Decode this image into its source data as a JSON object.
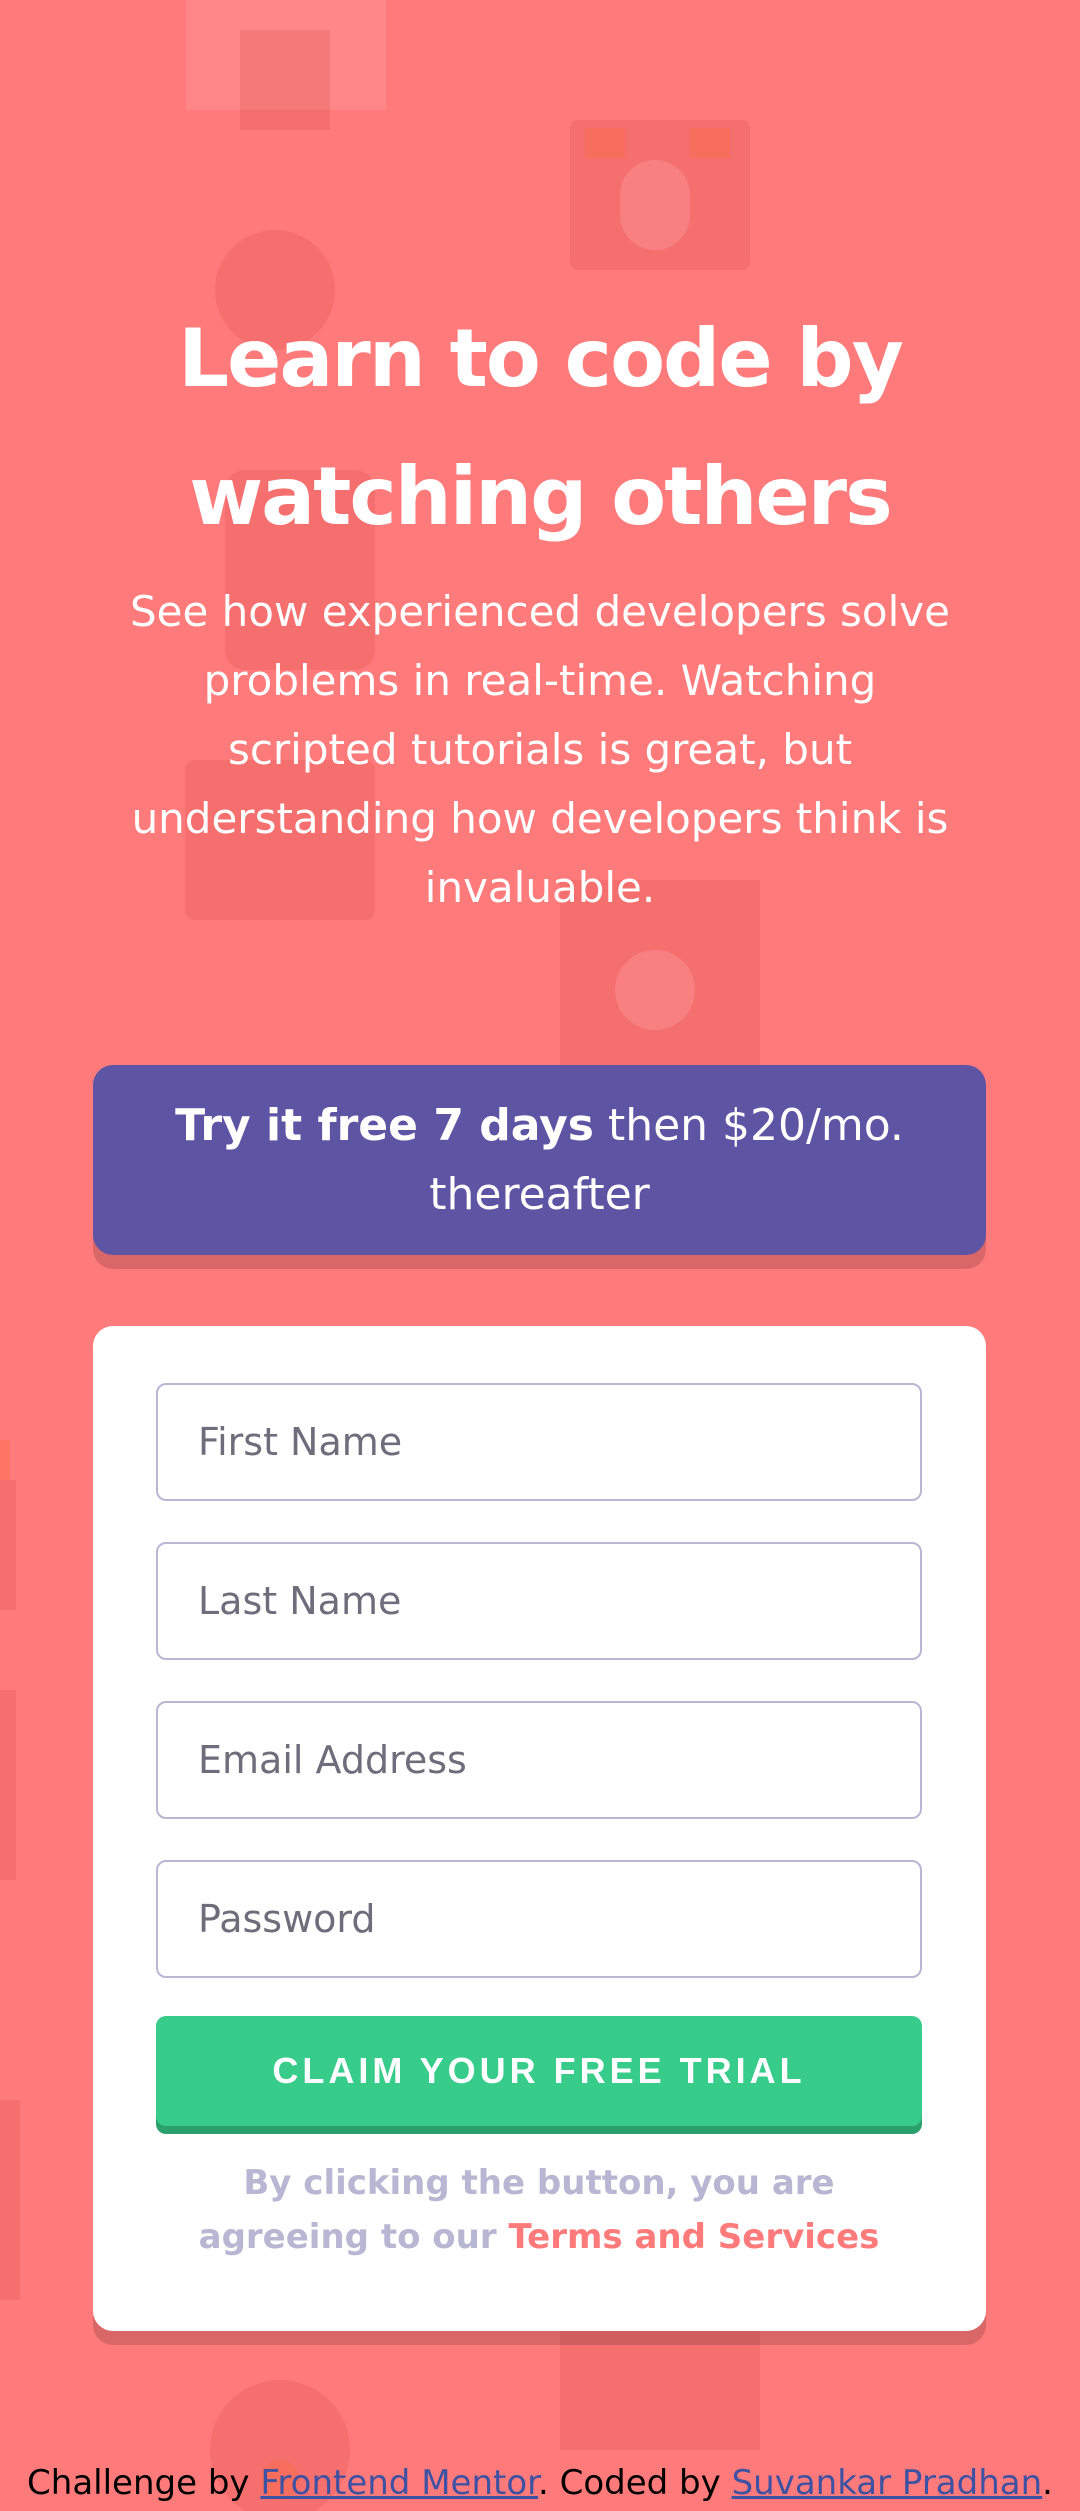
{
  "hero": {
    "title_line1": "Learn to code by",
    "title_line2": "watching others",
    "description": "See how experienced developers solve problems in real-time. Watching scripted tutorials is great, but understanding how developers think is invaluable."
  },
  "offer": {
    "bold_text": "Try it free 7 days",
    "rest_text": " then $20/mo. thereafter"
  },
  "form": {
    "first_name_placeholder": "First Name",
    "last_name_placeholder": "Last Name",
    "email_placeholder": "Email Address",
    "password_placeholder": "Password",
    "submit_label": "CLAIM YOUR FREE TRIAL",
    "terms_prefix": "By clicking the button, you are agreeing to our ",
    "terms_link": "Terms and Services"
  },
  "footer": {
    "challenge_prefix": "Challenge by ",
    "challenge_link": "Frontend Mentor",
    "coded_prefix": ". Coded by ",
    "author_link": "Suvankar Pradhan",
    "suffix": "."
  },
  "colors": {
    "background": "#ff7a7a",
    "banner": "#5e54a4",
    "button": "#38cc8b",
    "terms_link": "#ff7a7a",
    "muted": "#b9b6d3"
  },
  "icons": {
    "background_pattern": "decorative-pattern"
  }
}
